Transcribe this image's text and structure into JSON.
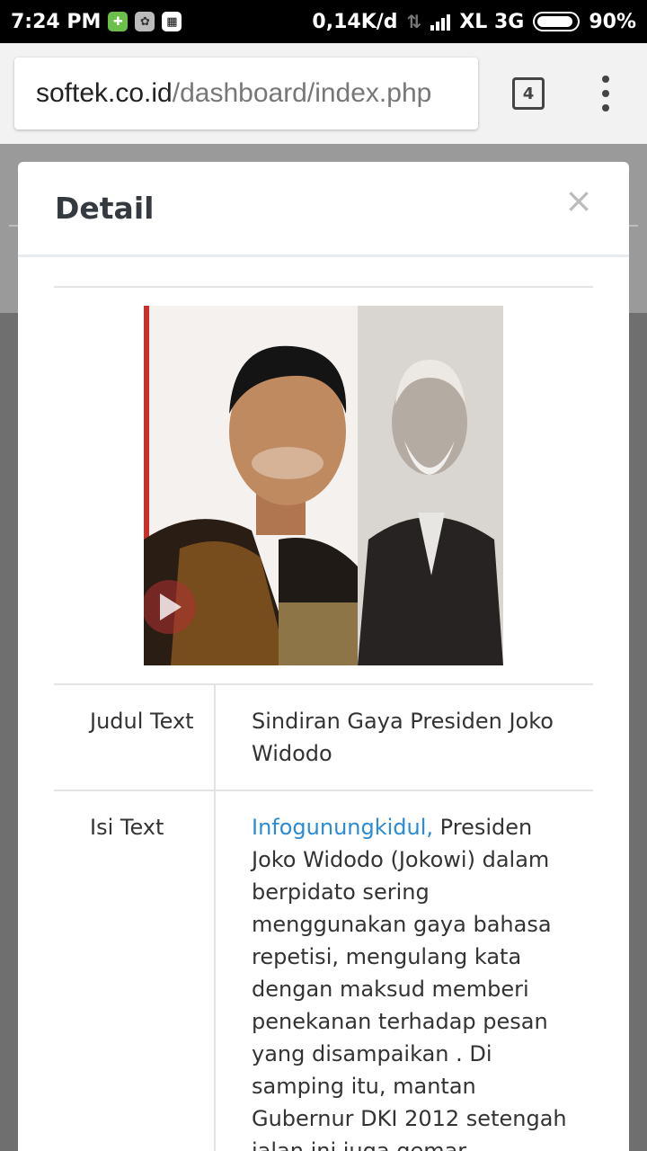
{
  "status_bar": {
    "time": "7:24 PM",
    "network_speed": "0,14K/d",
    "carrier": "XL 3G",
    "battery": "90%"
  },
  "browser": {
    "url_host": "softek.co.id",
    "url_path": "/dashboard/index.php",
    "tab_count": "4"
  },
  "modal": {
    "title": "Detail",
    "close": "×",
    "rows": [
      {
        "label": "Judul Text",
        "value": "Sindiran Gaya Presiden Joko Widodo"
      },
      {
        "label": "Isi Text",
        "link_text": "Infogunungkidul,",
        "value": " Presiden Joko Widodo (Jokowi) dalam berpidato sering menggunakan gaya bahasa repetisi, mengulang kata dengan maksud memberi penekanan terhadap pesan yang disampaikan . Di samping itu, mantan Gubernur DKI 2012 setengah jalan ini juga gemar"
      }
    ]
  },
  "icons": {
    "status": [
      "shield-icon",
      "app-icon",
      "bbm-icon",
      "data-arrows-icon",
      "signal-icon",
      "battery-icon"
    ],
    "browser": [
      "tabs-icon",
      "overflow-menu-icon"
    ]
  }
}
